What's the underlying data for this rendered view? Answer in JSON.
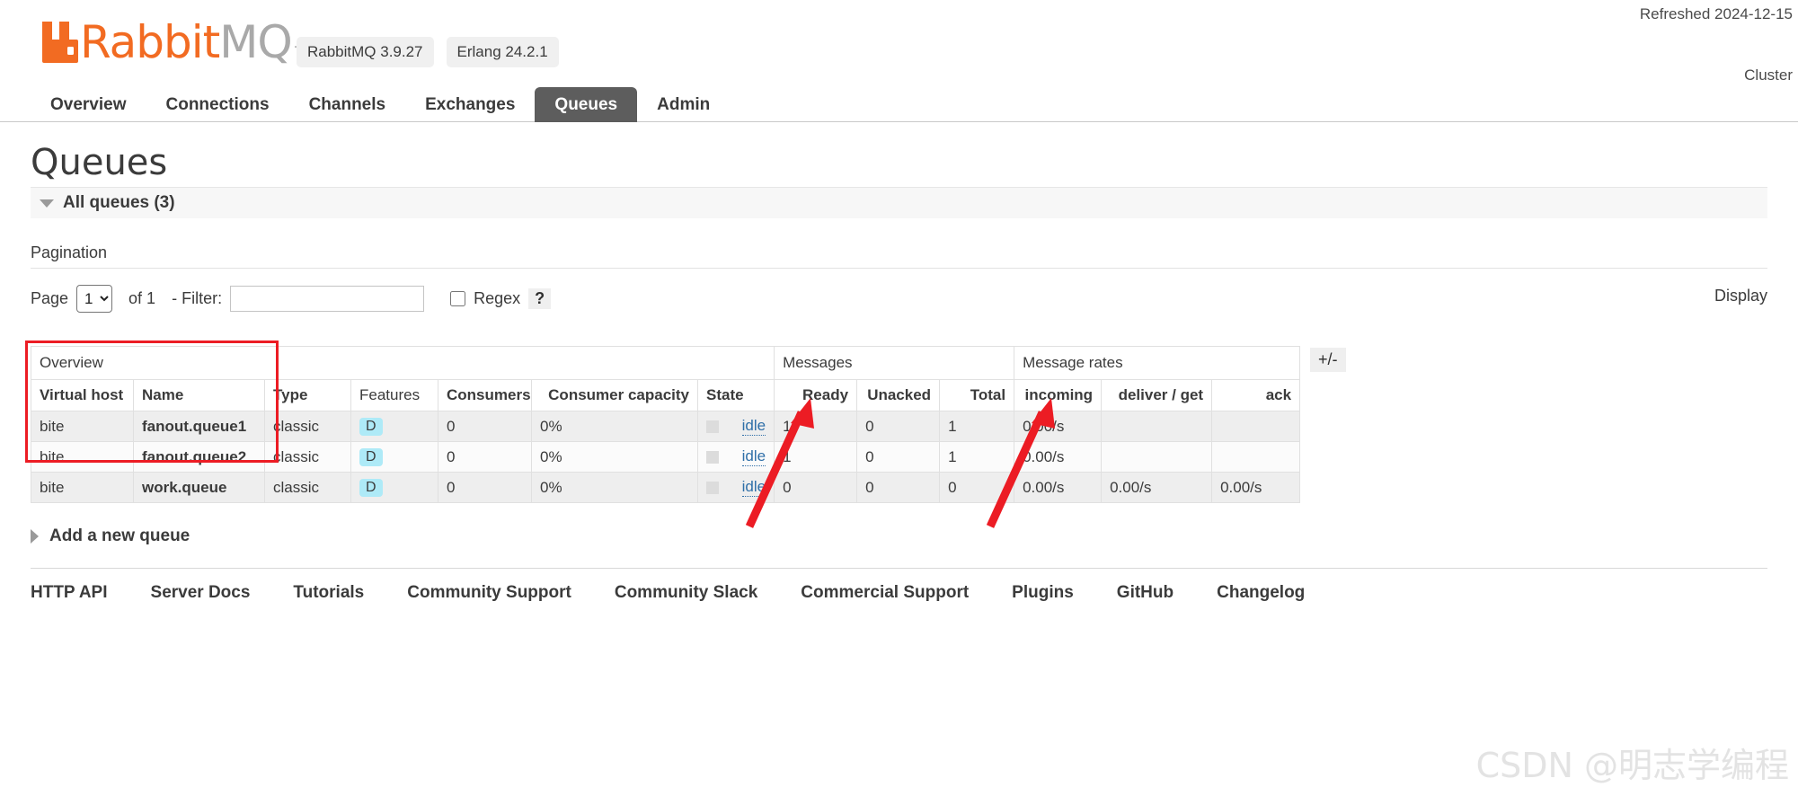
{
  "header": {
    "logo_rabbit": "Rabbit",
    "logo_mq": "MQ",
    "logo_tm": "TM",
    "version_badge": "RabbitMQ 3.9.27",
    "erlang_badge": "Erlang 24.2.1",
    "refreshed": "Refreshed 2024-12-15",
    "cluster": "Cluster"
  },
  "nav": {
    "tabs": [
      {
        "label": "Overview",
        "active": false
      },
      {
        "label": "Connections",
        "active": false
      },
      {
        "label": "Channels",
        "active": false
      },
      {
        "label": "Exchanges",
        "active": false
      },
      {
        "label": "Queues",
        "active": true
      },
      {
        "label": "Admin",
        "active": false
      }
    ]
  },
  "main": {
    "title": "Queues",
    "all_queues_label": "All queues (3)",
    "pagination_label": "Pagination",
    "display_label": "Display"
  },
  "filter": {
    "page_label": "Page",
    "page_value": "1",
    "page_options": [
      "1"
    ],
    "of_label": "of 1",
    "filter_label": "- Filter:",
    "filter_value": "",
    "filter_placeholder": "",
    "regex_label": "Regex",
    "regex_checked": false,
    "help_label": "?"
  },
  "table": {
    "plus_minus_label": "+/-",
    "groups": {
      "overview": "Overview",
      "messages": "Messages",
      "message_rates": "Message rates"
    },
    "columns": [
      "Virtual host",
      "Name",
      "Type",
      "Features",
      "Consumers",
      "Consumer capacity",
      "State",
      "Ready",
      "Unacked",
      "Total",
      "incoming",
      "deliver / get",
      "ack"
    ],
    "rows": [
      {
        "vhost": "bite",
        "name": "fanout.queue1",
        "type": "classic",
        "features": "D",
        "consumers": "0",
        "consumer_capacity": "0%",
        "state": "idle",
        "ready": "1",
        "unacked": "0",
        "total": "1",
        "incoming": "0.00/s",
        "deliver_get": "",
        "ack": ""
      },
      {
        "vhost": "bite",
        "name": "fanout.queue2",
        "type": "classic",
        "features": "D",
        "consumers": "0",
        "consumer_capacity": "0%",
        "state": "idle",
        "ready": "1",
        "unacked": "0",
        "total": "1",
        "incoming": "0.00/s",
        "deliver_get": "",
        "ack": ""
      },
      {
        "vhost": "bite",
        "name": "work.queue",
        "type": "classic",
        "features": "D",
        "consumers": "0",
        "consumer_capacity": "0%",
        "state": "idle",
        "ready": "0",
        "unacked": "0",
        "total": "0",
        "incoming": "0.00/s",
        "deliver_get": "0.00/s",
        "ack": "0.00/s"
      }
    ]
  },
  "add_queue_label": "Add a new queue",
  "footer": {
    "links": [
      "HTTP API",
      "Server Docs",
      "Tutorials",
      "Community Support",
      "Community Slack",
      "Commercial Support",
      "Plugins",
      "GitHub",
      "Changelog"
    ]
  },
  "watermark": "CSDN @明志学编程",
  "colors": {
    "brand_orange": "#f26b22",
    "tab_active_bg": "#5d5d5d",
    "annotation_red": "#ec1c24",
    "feature_badge_bg": "#aeeaf7"
  }
}
